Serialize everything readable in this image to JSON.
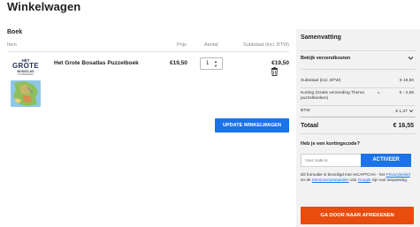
{
  "page": {
    "title": "Winkelwagen"
  },
  "cart": {
    "section_title": "Boek",
    "columns": {
      "item": "Item",
      "price": "Prijs",
      "qty": "Aantal",
      "subtotal": "Subtotaal (incl. BTW)"
    },
    "items": [
      {
        "name": "Het Grote Bosatlas Puzzelboek",
        "price": "€19,50",
        "quantity": "1",
        "subtotal": "€19,50",
        "cover": {
          "line1": "HET",
          "line2": "GROTE",
          "line3": "BOSATLAS",
          "line4": "PUZZELBOEK"
        }
      }
    ],
    "update_label": "UPDATE WINKELWAGEN"
  },
  "summary": {
    "title": "Samenvatting",
    "shipping_label": "Bekijk verzendkosten",
    "subtotal_label": "Subtotaal (incl. BTW)",
    "subtotal_value": "€ 19,50",
    "discount_label": "Korting (Gratis verzending Thema puzzelboeken)",
    "discount_value": "€ - 2,95",
    "btw_label": "BTW",
    "btw_value": "€ 1,37",
    "total_label": "Totaal",
    "total_value": "€ 16,55"
  },
  "coupon": {
    "title": "Heb je een kortingscode?",
    "placeholder": "Voer code in",
    "apply_label": "ACTIVEER"
  },
  "captcha": {
    "text_before": "Dit formulier is beveiligd met reCAPTCHA - het ",
    "privacy_link": "Privacybeleid",
    "text_middle": " en de ",
    "terms_link": "Servicevoorwaarden",
    "text_after": " van ",
    "google_link": "Google",
    "text_end": " zijn van toepassing."
  },
  "checkout": {
    "label": "GA DOOR NAAR AFREKENEN"
  },
  "colors": {
    "primary": "#1a73e8",
    "checkout": "#e84c0e",
    "summary_bg": "#f2f2f2"
  }
}
